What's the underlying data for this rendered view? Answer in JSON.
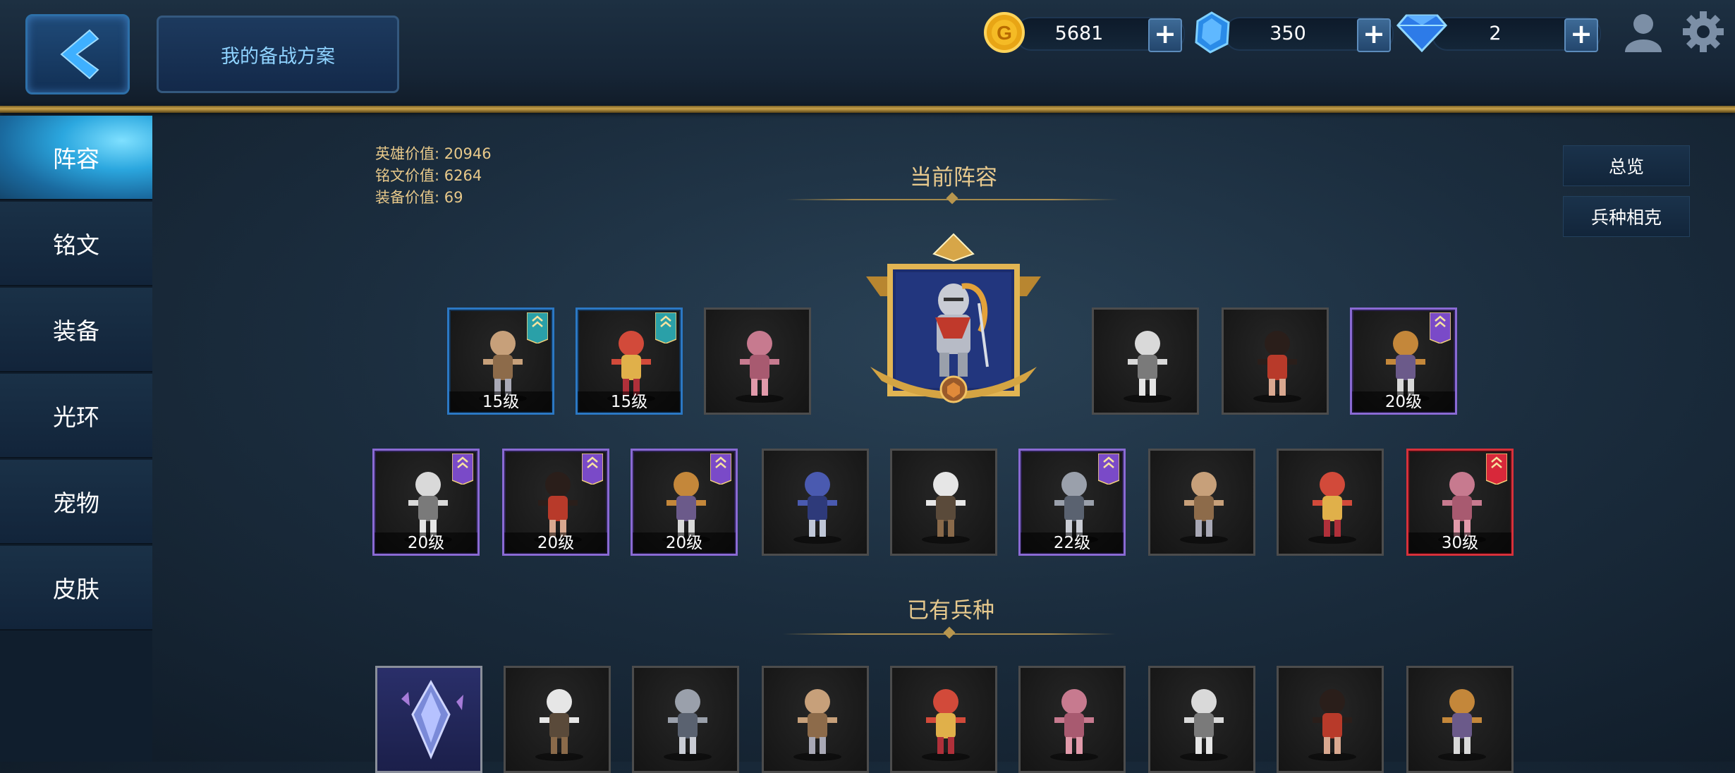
{
  "header": {
    "plan_label": "我的备战方案",
    "gold": "5681",
    "crystal": "350",
    "diamond": "2"
  },
  "sidebar": {
    "items": [
      {
        "label": "阵容",
        "active": true
      },
      {
        "label": "铭文",
        "active": false
      },
      {
        "label": "装备",
        "active": false
      },
      {
        "label": "光环",
        "active": false
      },
      {
        "label": "宠物",
        "active": false
      },
      {
        "label": "皮肤",
        "active": false
      }
    ]
  },
  "stats": {
    "hero_value": "英雄价值: 20946",
    "rune_value": "铭文价值: 6264",
    "equip_value": "装备价值: 69"
  },
  "sections": {
    "current_lineup": "当前阵容",
    "owned_units": "已有兵种"
  },
  "right_buttons": {
    "overview": "总览",
    "counter": "兵种相克"
  },
  "lineup_row1": [
    {
      "level": "15级",
      "frame": "blue",
      "badge": "teal"
    },
    {
      "level": "15级",
      "frame": "blue",
      "badge": "teal"
    },
    {
      "level": "",
      "frame": "gray",
      "badge": ""
    },
    {
      "level": "",
      "frame": "gray",
      "badge": ""
    },
    {
      "level": "",
      "frame": "gray",
      "badge": ""
    },
    {
      "level": "20级",
      "frame": "purple",
      "badge": "purple"
    }
  ],
  "lineup_row2": [
    {
      "level": "20级",
      "frame": "purple",
      "badge": "purple"
    },
    {
      "level": "20级",
      "frame": "purple",
      "badge": "purple"
    },
    {
      "level": "20级",
      "frame": "purple",
      "badge": "purple"
    },
    {
      "level": "",
      "frame": "gray",
      "badge": ""
    },
    {
      "level": "",
      "frame": "gray",
      "badge": ""
    },
    {
      "level": "22级",
      "frame": "purple",
      "badge": "purple"
    },
    {
      "level": "",
      "frame": "gray",
      "badge": ""
    },
    {
      "level": "",
      "frame": "gray",
      "badge": ""
    },
    {
      "level": "30级",
      "frame": "red",
      "badge": "red"
    }
  ],
  "owned_row": [
    {
      "level": "",
      "frame": "crystal"
    },
    {
      "level": "",
      "frame": "gray"
    },
    {
      "level": "",
      "frame": "gray"
    },
    {
      "level": "",
      "frame": "gray"
    },
    {
      "level": "",
      "frame": "gray"
    },
    {
      "level": "",
      "frame": "gray"
    },
    {
      "level": "",
      "frame": "gray"
    },
    {
      "level": "",
      "frame": "gray"
    },
    {
      "level": "",
      "frame": "gray"
    }
  ]
}
